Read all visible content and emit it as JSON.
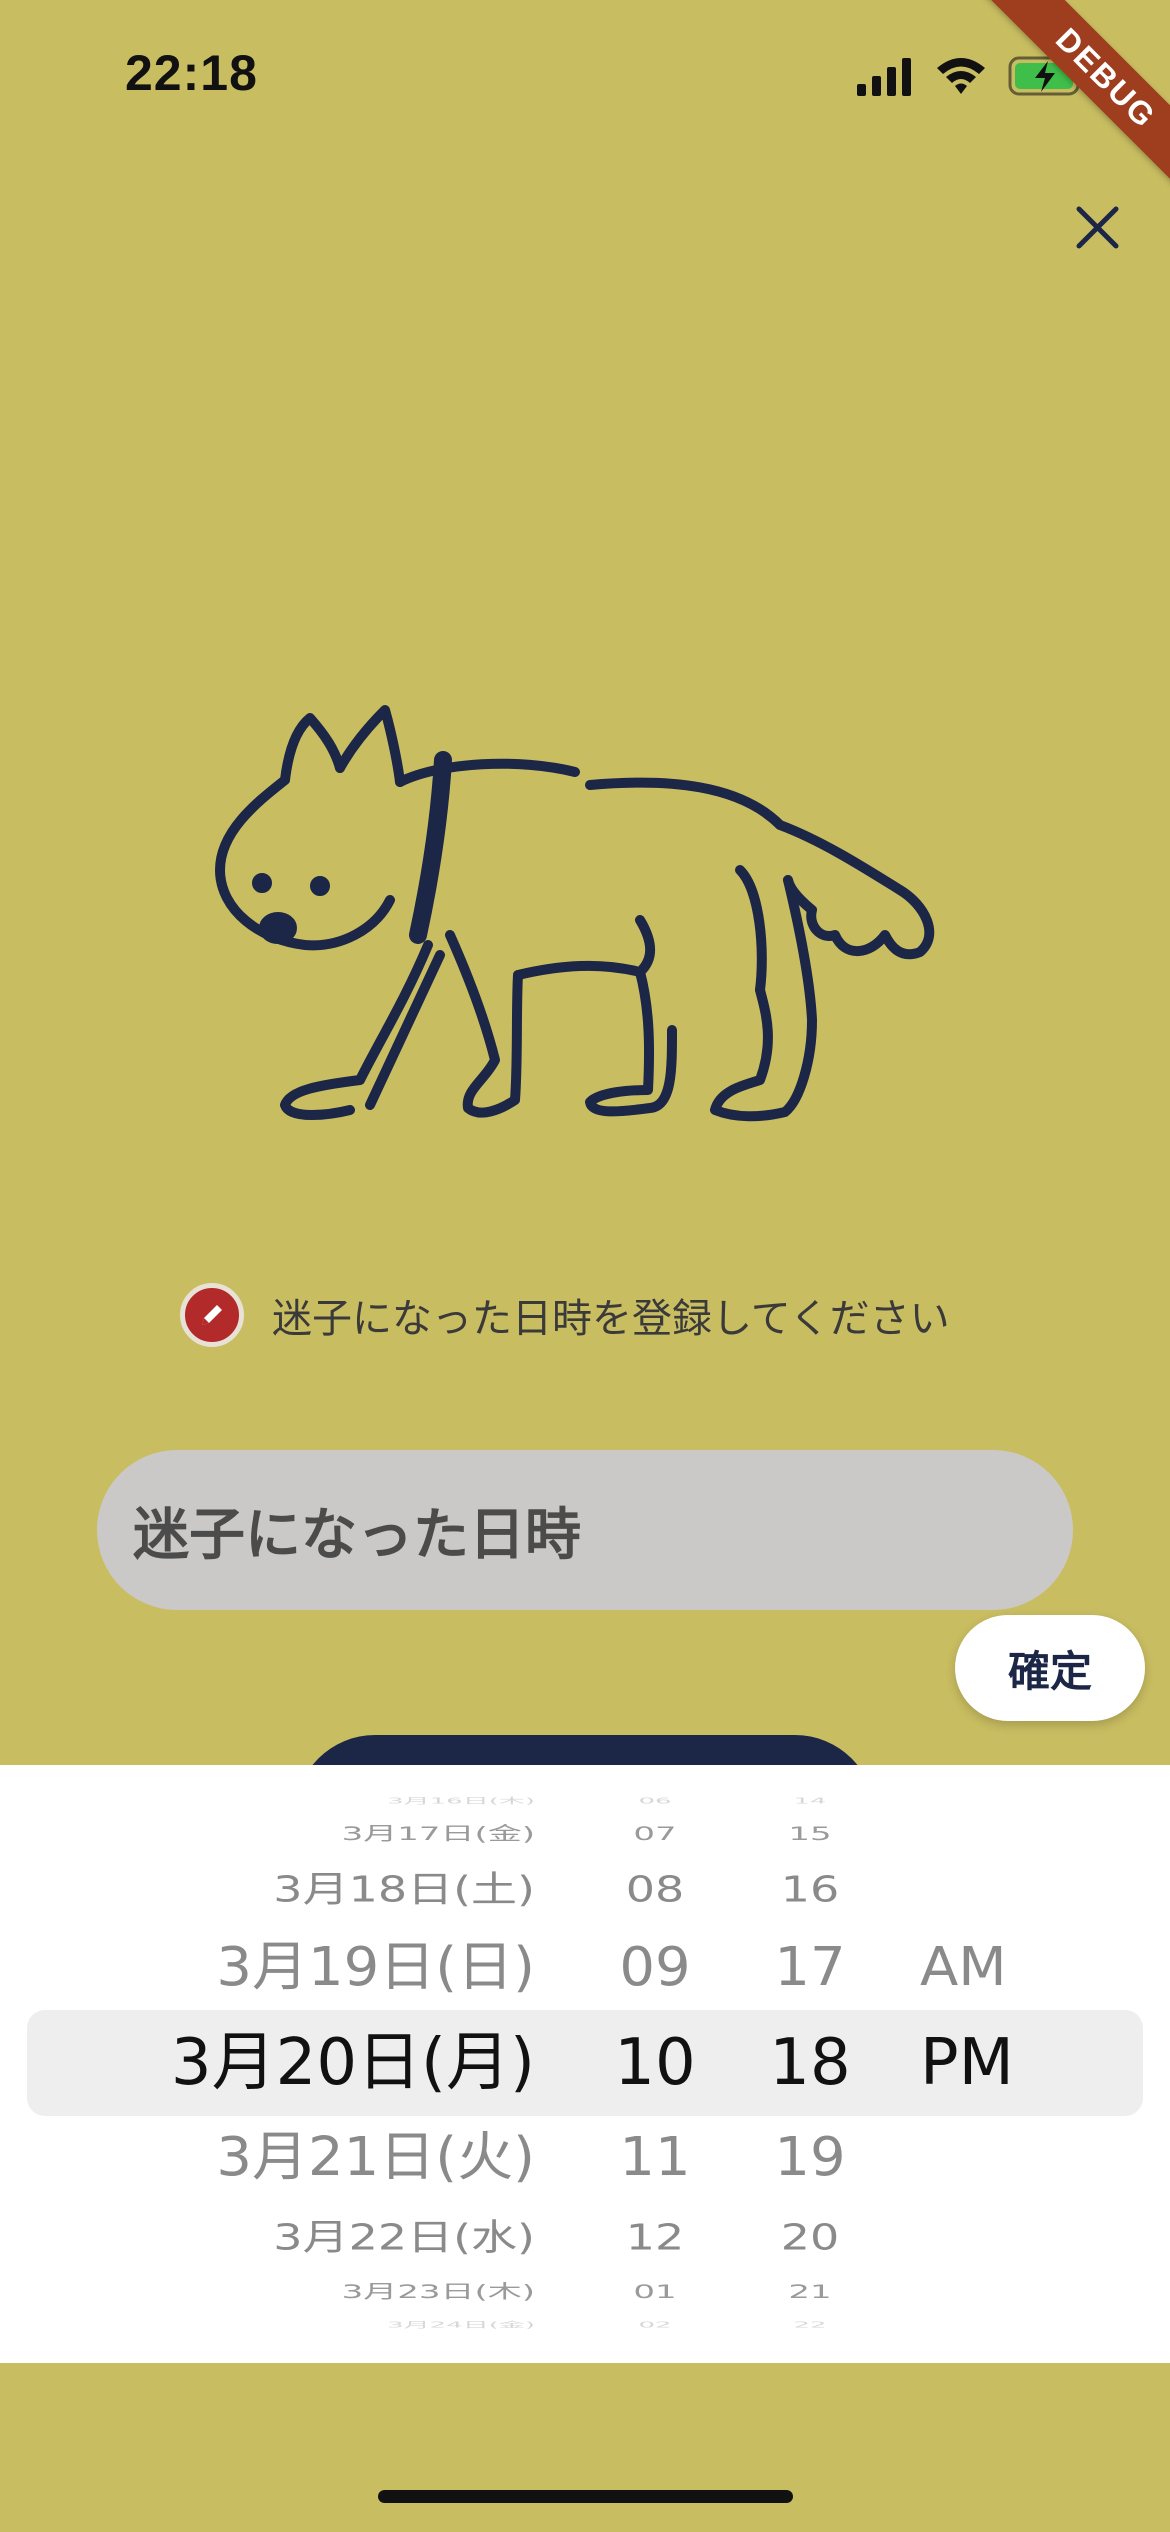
{
  "status_bar": {
    "time": "22:18",
    "debug_label": "DEBUG"
  },
  "instruction": {
    "text": "迷子になった日時を登録してください"
  },
  "datetime_field": {
    "label": "迷子になった日時"
  },
  "confirm_button": {
    "label": "確定"
  },
  "picker": {
    "dates": [
      "3月16日(木)",
      "3月17日(金)",
      "3月18日(土)",
      "3月19日(日)",
      "3月20日(月)",
      "3月21日(火)",
      "3月22日(水)",
      "3月23日(木)",
      "3月24日(金)"
    ],
    "hours": [
      "06",
      "07",
      "08",
      "09",
      "10",
      "11",
      "12",
      "01",
      "02"
    ],
    "minutes": [
      "14",
      "15",
      "16",
      "17",
      "18",
      "19",
      "20",
      "21",
      "22"
    ],
    "ampm": [
      "",
      "",
      "",
      "AM",
      "PM",
      "",
      "",
      "",
      ""
    ],
    "selected_index": 4,
    "selected": {
      "date": "3月20日(月)",
      "hour": "10",
      "minute": "18",
      "ampm": "PM"
    }
  },
  "colors": {
    "background": "#c9bd61",
    "navy": "#1c2647",
    "field": "#cbc9c8",
    "pencil_badge": "#b22a2a",
    "debug_banner": "#9e3e1f"
  },
  "icons": [
    "signal-icon",
    "wifi-icon",
    "battery-charging-icon",
    "close-icon",
    "pencil-icon",
    "dog-illustration"
  ]
}
